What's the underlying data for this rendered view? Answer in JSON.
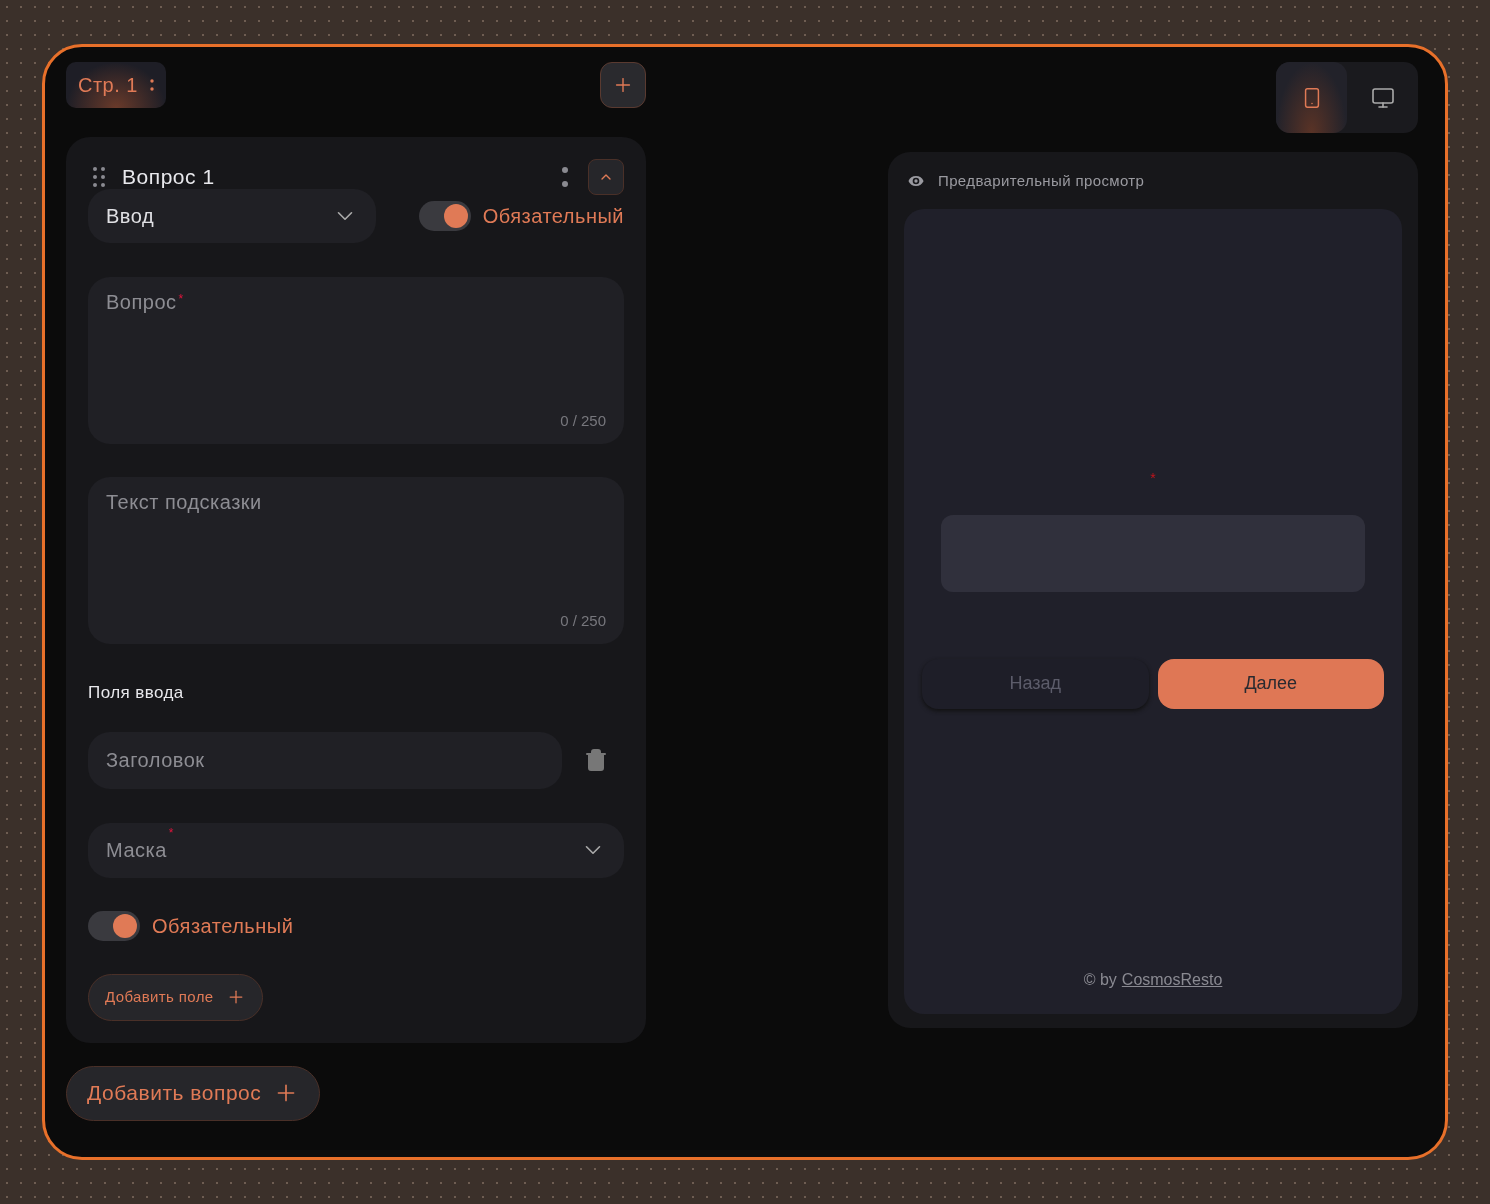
{
  "page_tab": {
    "label": "Стр. 1",
    "selected": true
  },
  "question": {
    "title": "Вопрос 1",
    "expanded": true,
    "type_select": {
      "value": "Ввод"
    },
    "required_toggle": {
      "label": "Обязательный",
      "on": true
    },
    "question_field": {
      "placeholder": "Вопрос",
      "required_mark": "*",
      "counter": "0 / 250"
    },
    "hint_field": {
      "placeholder": "Текст подсказки",
      "counter": "0 / 250"
    },
    "section_title": "Поля ввода",
    "input_fields": [
      {
        "title_placeholder": "Заголовок",
        "mask_placeholder": "Маска",
        "mask_required_mark": "*",
        "required_toggle": {
          "label": "Обязательный",
          "on": true
        }
      }
    ],
    "add_field_button": "Добавить поле"
  },
  "add_question_button": "Добавить вопрос",
  "device_tabs": [
    {
      "kind": "mobile",
      "selected": true
    },
    {
      "kind": "desktop",
      "selected": false
    }
  ],
  "preview": {
    "title": "Предварительный просмотр",
    "required_mark": "*",
    "back_button": {
      "label": "Назад",
      "disabled": true
    },
    "next_button": {
      "label": "Далее",
      "disabled": false
    },
    "footer": {
      "prefix": "© by",
      "link": "CosmosResto"
    }
  }
}
